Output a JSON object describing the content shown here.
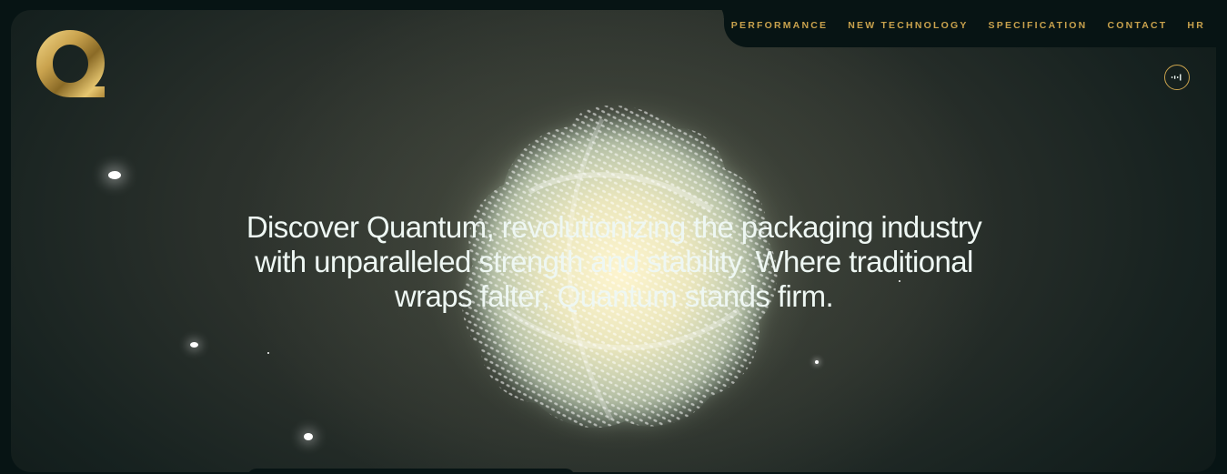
{
  "nav": {
    "items": [
      {
        "label": "PERFORMANCE"
      },
      {
        "label": "NEW TECHNOLOGY"
      },
      {
        "label": "SPECIFICATION"
      },
      {
        "label": "CONTACT"
      },
      {
        "label": "HR"
      }
    ]
  },
  "hero": {
    "line1": "Discover Quantum, revolutionizing the packaging industry",
    "line2": "with unparalleled strength and stability. Where traditional",
    "line3": "wraps falter, Quantum stands firm."
  },
  "colors": {
    "accent_gold": "#c9a24d",
    "background": "#071414",
    "text": "#eef7f3"
  },
  "icons": {
    "logo": "quantum-q-logo",
    "sound": "sound-wave-icon"
  }
}
